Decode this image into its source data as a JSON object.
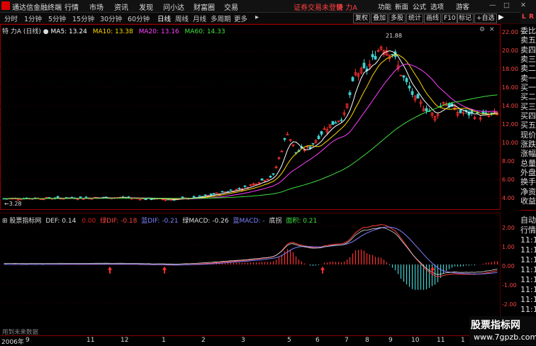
{
  "menu": {
    "app_title": "通达信金融终端",
    "items": [
      "行情",
      "市场",
      "资讯",
      "发现",
      "问小达",
      "财富圈",
      "交易"
    ],
    "notice": "证券交易未登录",
    "stock_name": "特 力A",
    "right_items": [
      "功能",
      "新面",
      "公式",
      "选项",
      "游客"
    ]
  },
  "periods": [
    "分时",
    "1分钟",
    "5分钟",
    "15分钟",
    "30分钟",
    "60分钟",
    "日线",
    "周线",
    "月线",
    "多周期",
    "更多"
  ],
  "active_period": "日线",
  "tools": [
    "复权",
    "叠加",
    "多股",
    "统计",
    "画线",
    "F10",
    "标记",
    "+自选"
  ],
  "price_panel": {
    "title": "特 力A (日线)",
    "ma": [
      {
        "label": "MA5: 13.24",
        "color": "#ffffff"
      },
      {
        "label": "MA10: 13.38",
        "color": "#ffd800"
      },
      {
        "label": "MA20: 13.16",
        "color": "#ff40ff"
      },
      {
        "label": "MA60: 14.33",
        "color": "#40e040"
      }
    ],
    "high_label": "21.88",
    "low_label": "3.28",
    "yaxis": [
      "22.00",
      "20.00",
      "18.00",
      "16.00",
      "14.00",
      "12.00",
      "10.00",
      "8.00",
      "6.00",
      "4.00"
    ]
  },
  "macd_panel": {
    "title": "股票指标网",
    "legend": [
      {
        "label": "DEF: 0.14",
        "color": "#dddddd"
      },
      {
        "label": "0.00",
        "color": "#dd2020"
      },
      {
        "label": "绿DIF: -0.18",
        "color": "#ff4040"
      },
      {
        "label": "蓝DIF: -0.21",
        "color": "#8080ff"
      },
      {
        "label": "绿MACD: -0.26",
        "color": "#dddddd"
      },
      {
        "label": "蓝MACD: -",
        "color": "#8080ff"
      },
      {
        "label": "底拐",
        "color": "#dddddd"
      },
      {
        "label": "面积: 0.21",
        "color": "#40e040"
      }
    ],
    "yaxis": [
      "2.00",
      "1.00",
      "0.00",
      "-1.00",
      "-2.00"
    ],
    "footer": "用到未来数据"
  },
  "side": {
    "top_labels": [
      "L",
      "R"
    ],
    "items": [
      "委比",
      "卖五",
      "卖四",
      "卖三",
      "卖二",
      "卖一",
      "买一",
      "买二",
      "买三",
      "买四",
      "买五",
      "现价",
      "涨跌",
      "涨幅",
      "总量",
      "外盘",
      "换手",
      "净资",
      "收益"
    ],
    "bottom_items": [
      "自动",
      "行情",
      "11:1",
      "11:1",
      "11:1",
      "11:1",
      "11:1",
      "11:1",
      "11:1",
      "11:1"
    ]
  },
  "time_axis": [
    "2006年",
    "9",
    "11",
    "12",
    "1",
    "2",
    "3",
    "5",
    "6",
    "7",
    "8",
    "9",
    "10",
    "11",
    "1"
  ],
  "watermark": {
    "title": "股票指标网",
    "url": "www.7gpzb.com"
  },
  "colors": {
    "up": "#ff3030",
    "down": "#40d0d0",
    "grid_red": "#990000",
    "ma5": "#ffffff",
    "ma10": "#ffd800",
    "ma20": "#ff40ff",
    "ma60": "#40e040"
  }
}
